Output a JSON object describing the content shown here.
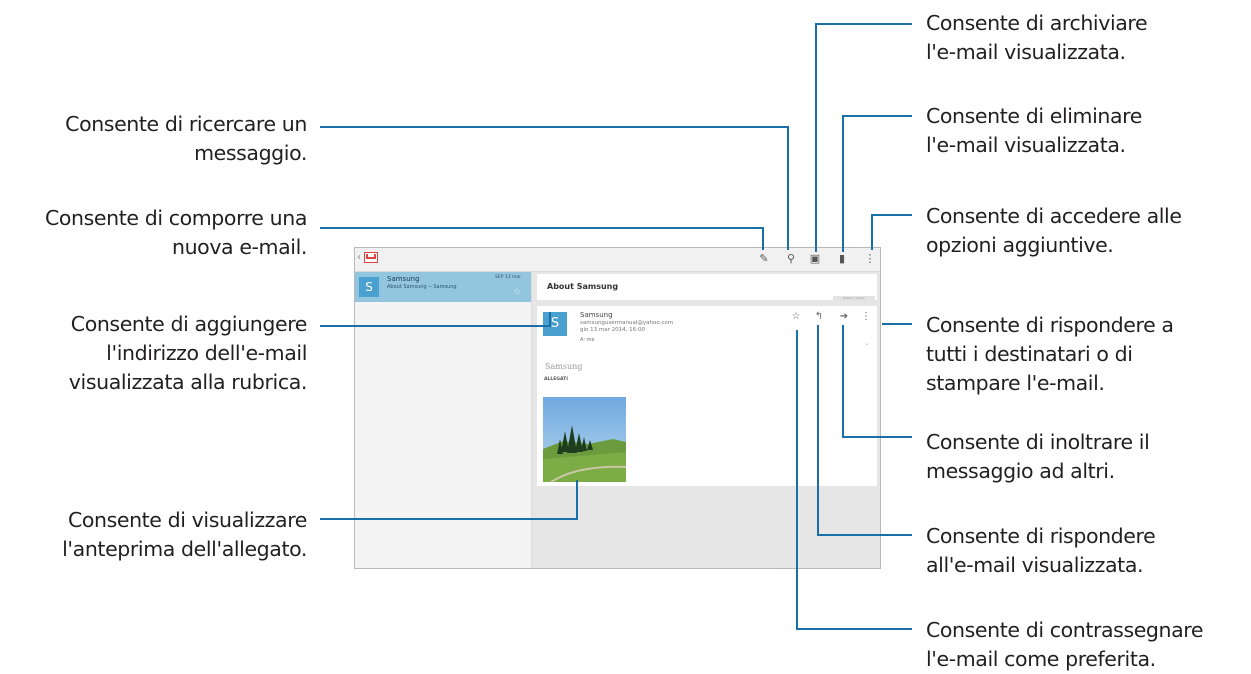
{
  "callouts_left": [
    {
      "id": "search",
      "lines": [
        "Consente di ricercare un",
        "messaggio."
      ]
    },
    {
      "id": "compose",
      "lines": [
        "Consente di comporre una",
        "nuova e-mail."
      ]
    },
    {
      "id": "contacts",
      "lines": [
        "Consente di aggiungere",
        "l'indirizzo dell'e-mail",
        "visualizzata alla rubrica."
      ]
    },
    {
      "id": "preview",
      "lines": [
        "Consente di visualizzare",
        "l'anteprima dell'allegato."
      ]
    }
  ],
  "callouts_right": [
    {
      "id": "archive",
      "lines": [
        "Consente di archiviare",
        "l'e-mail visualizzata."
      ]
    },
    {
      "id": "delete",
      "lines": [
        "Consente di eliminare",
        "l'e-mail visualizzata."
      ]
    },
    {
      "id": "more",
      "lines": [
        "Consente di accedere alle",
        "opzioni aggiuntive."
      ]
    },
    {
      "id": "replyall",
      "lines": [
        "Consente di rispondere a",
        "tutti i destinatari o di",
        "stampare l'e-mail."
      ]
    },
    {
      "id": "forward",
      "lines": [
        "Consente di inoltrare il",
        "messaggio ad altri."
      ]
    },
    {
      "id": "reply",
      "lines": [
        "Consente di rispondere",
        "all'e-mail visualizzata."
      ]
    },
    {
      "id": "star",
      "lines": [
        "Consente di contrassegnare",
        "l'e-mail come preferita."
      ]
    }
  ],
  "screen": {
    "list_item": {
      "avatar": "S",
      "sender": "Samsung",
      "subject": "About Samsung -- Samsung",
      "date": "SEP 13 mar"
    },
    "subject": "About Samsung",
    "subject_button": "Posta in arrivo",
    "message": {
      "avatar": "S",
      "sender": "Samsung",
      "address": "samsungusermanual@yahoo.com",
      "date": "gio 13 mar 2014, 16:00",
      "to": "A: me",
      "signature": "Samsung",
      "attachments_label": "ALLEGATI"
    },
    "icons": {
      "compose": "compose-icon",
      "search": "search-icon",
      "archive": "archive-icon",
      "delete": "trash-icon",
      "more": "overflow-menu-icon",
      "star": "star-icon",
      "reply": "reply-icon",
      "forward": "forward-icon",
      "msg_more": "overflow-menu-icon"
    }
  }
}
